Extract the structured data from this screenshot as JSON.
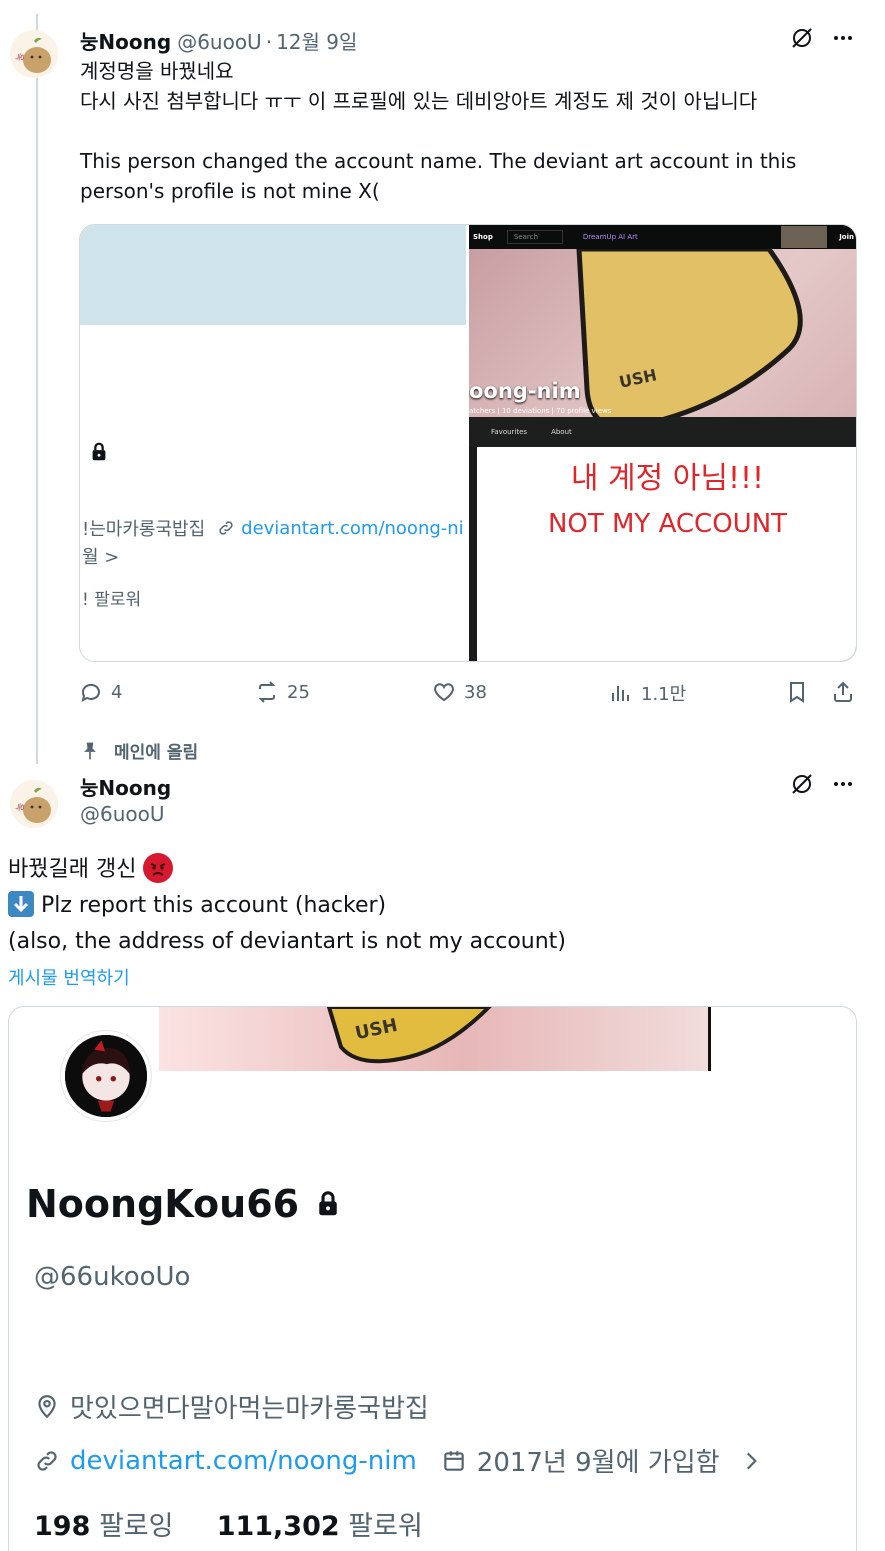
{
  "tweet1": {
    "display_name": "눙Noong",
    "handle": "@6uooU",
    "sep": "·",
    "date": "12월 9일",
    "text": "계정명을 바꿨네요\n다시 사진 첨부합니다 ㅠㅜ 이 프로필에 있는 데비앙아트 계정도 제 것이 아닙니다\n\nThis person changed the account name. The deviant art account in this person's profile is not mine X(",
    "media_left": {
      "location_fragment": "!는마카롱국밥집",
      "link_fragment": "deviantart.com/noong-ni",
      "date_fragment": "월 >",
      "followers_fragment": "! 팔로워"
    },
    "media_right": {
      "nav_shop": "Shop",
      "nav_search": "Search",
      "nav_dreamup": "DreamUp AI Art",
      "nav_join": "Join",
      "profile_name": "oong-nim",
      "profile_stats": "atchers | 10 deviations | 70 profile views",
      "tab_favourites": "Favourites",
      "tab_about": "About",
      "overlay_ko": "내 계정 아님!!!",
      "overlay_en": "NOT MY ACCOUNT",
      "art_text": "USH"
    },
    "actions": {
      "replies": "4",
      "retweets": "25",
      "likes": "38",
      "views": "1.1만"
    }
  },
  "pinned_label": "메인에 올림",
  "tweet2": {
    "display_name": "눙Noong",
    "handle": "@6uooU",
    "line1": "바꿨길래 갱신",
    "emoji_angry": "😡",
    "emoji_down": "⬇️",
    "line2": "Plz report this account (hacker)",
    "line3": "(also, the address of deviantart is not my account)",
    "translate": "게시물 번역하기",
    "profile_card": {
      "banner_text": "USH",
      "name": "NoongKou66",
      "handle": "@66ukooUo",
      "location": "맛있으면다말아먹는마카롱국밥집",
      "link": "deviantart.com/noong-nim",
      "joined": "2017년 9월에 가입함",
      "following_count": "198",
      "following_label": "팔로잉",
      "followers_count": "111,302",
      "followers_label": "팔로워"
    }
  },
  "colors": {
    "accent": "#1d9bf0",
    "muted": "#536471",
    "text": "#0f1419",
    "border": "#cfd9de",
    "red": "#e0262a"
  }
}
